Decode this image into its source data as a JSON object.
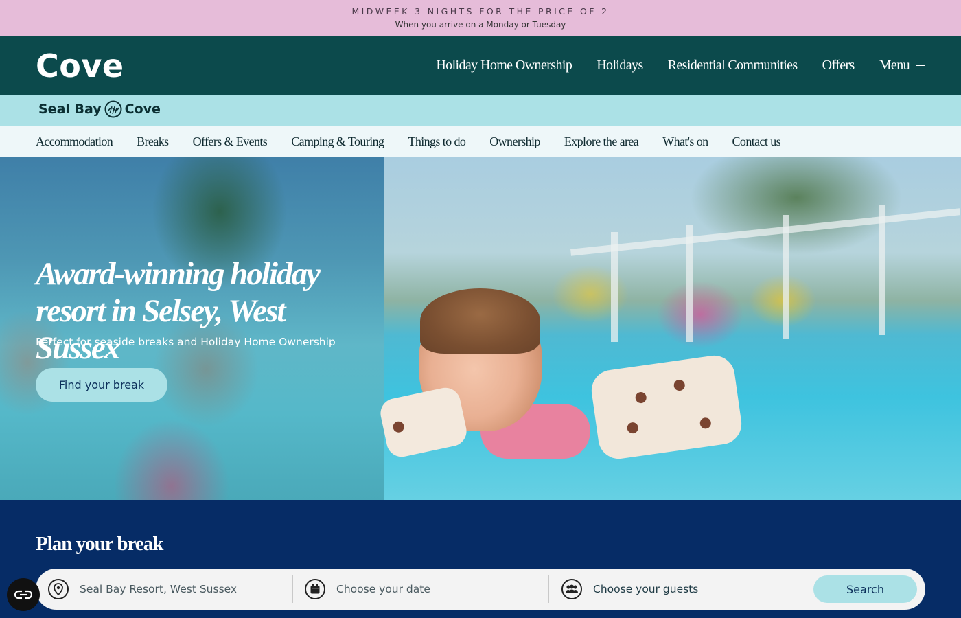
{
  "promo": {
    "title": "MIDWEEK 3 NIGHTS FOR THE PRICE OF 2",
    "subtitle": "When you arrive on a Monday or Tuesday"
  },
  "header": {
    "logo": "Cove",
    "nav": [
      {
        "label": "Holiday Home Ownership"
      },
      {
        "label": "Holidays"
      },
      {
        "label": "Residential Communities"
      },
      {
        "label": "Offers"
      },
      {
        "label": "Menu"
      }
    ]
  },
  "resort": {
    "name_left": "Seal Bay",
    "name_right": "Cove"
  },
  "subnav": [
    {
      "label": "Accommodation"
    },
    {
      "label": "Breaks"
    },
    {
      "label": "Offers & Events"
    },
    {
      "label": "Camping & Touring"
    },
    {
      "label": "Things to do"
    },
    {
      "label": "Ownership"
    },
    {
      "label": "Explore the area"
    },
    {
      "label": "What's on"
    },
    {
      "label": "Contact us"
    }
  ],
  "hero": {
    "title_line1": "Award-winning holiday",
    "title_line2": "resort in Selsey, West Sussex",
    "subtitle": "Perfect for seaside breaks and Holiday Home Ownership",
    "cta": "Find your break"
  },
  "plan": {
    "title": "Plan your break",
    "location": "Seal Bay Resort, West Sussex",
    "date_placeholder": "Choose your date",
    "guests_placeholder": "Choose your guests",
    "search_label": "Search"
  },
  "colors": {
    "promo_bg": "#e6bcd9",
    "header_bg": "#0c4a4c",
    "resort_bg": "#abe1e6",
    "subnav_bg": "#eef7f9",
    "plan_bg": "#062c66",
    "accent": "#abe1e6"
  },
  "icons": {
    "location": "map-pin-icon",
    "date": "calendar-icon",
    "guests": "guests-icon",
    "menu": "hamburger-icon",
    "accessibility": "accessibility-icon"
  }
}
